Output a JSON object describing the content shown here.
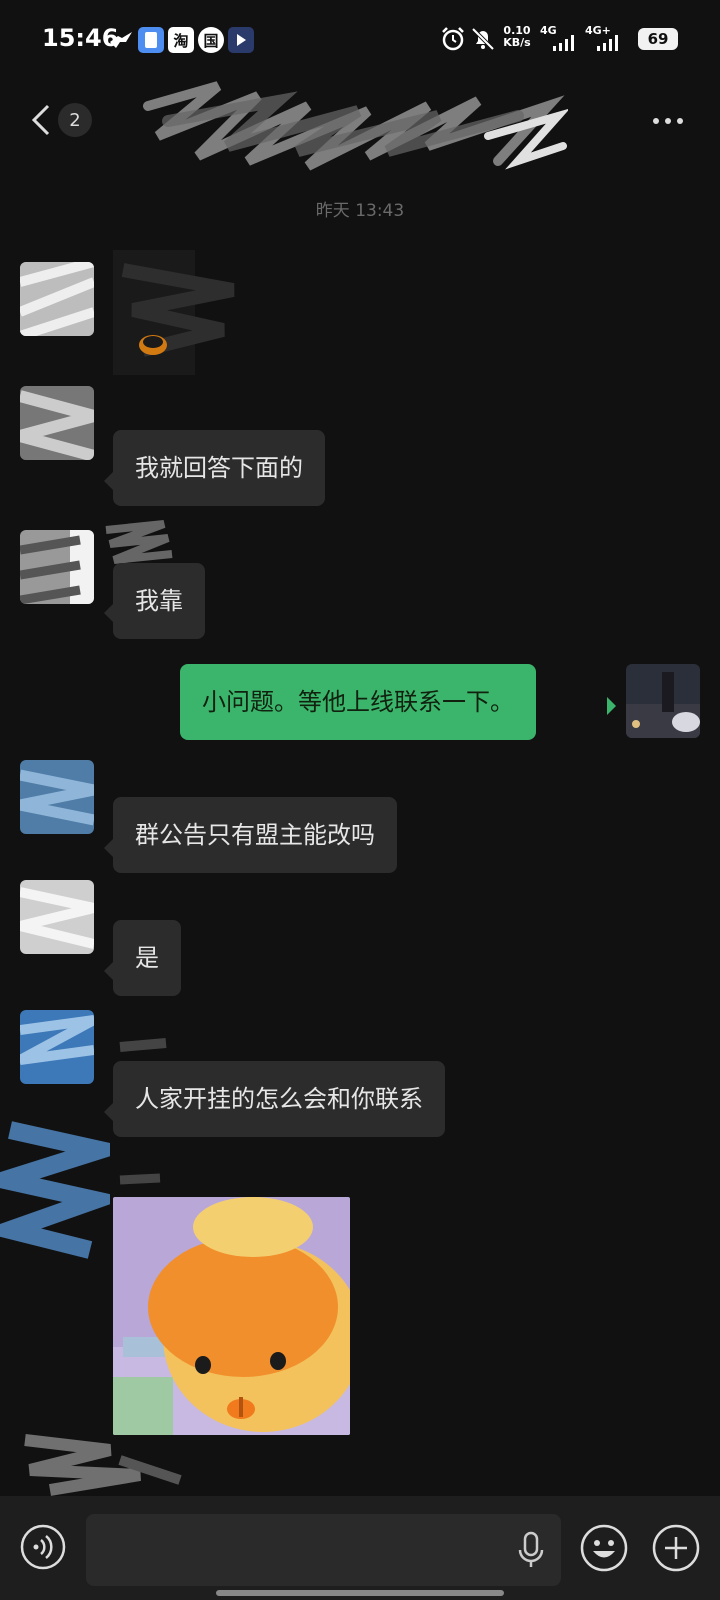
{
  "status_bar": {
    "time": "15:46",
    "app_icons": [
      "bird-icon",
      "file-icon",
      "淘",
      "国",
      "video-icon"
    ],
    "speed_value": "0.10",
    "speed_unit": "KB/s",
    "net1": "4G",
    "net2": "4G+",
    "battery": "69"
  },
  "header": {
    "back_count": "2",
    "title": ""
  },
  "chat": {
    "timestamp": "昨天 13:43",
    "messages": [
      {
        "side": "left",
        "type": "image"
      },
      {
        "side": "left",
        "type": "text",
        "text": "我就回答下面的"
      },
      {
        "side": "left",
        "type": "text",
        "text": "我靠"
      },
      {
        "side": "right",
        "type": "text",
        "text": "小问题。等他上线联系一下。"
      },
      {
        "side": "left",
        "type": "text",
        "text": "群公告只有盟主能改吗"
      },
      {
        "side": "left",
        "type": "text",
        "text": "是"
      },
      {
        "side": "left",
        "type": "text",
        "text": "人家开挂的怎么会和你联系"
      },
      {
        "side": "left",
        "type": "sticker",
        "sticker": "orange-duck-sticker"
      }
    ]
  },
  "input_bar": {
    "placeholder": "",
    "icons": [
      "voice-icon",
      "microphone-icon",
      "emoji-icon",
      "plus-icon"
    ]
  },
  "colors": {
    "background": "#111111",
    "bubble_other": "#2c2c2c",
    "bubble_mine": "#3bb56b"
  }
}
